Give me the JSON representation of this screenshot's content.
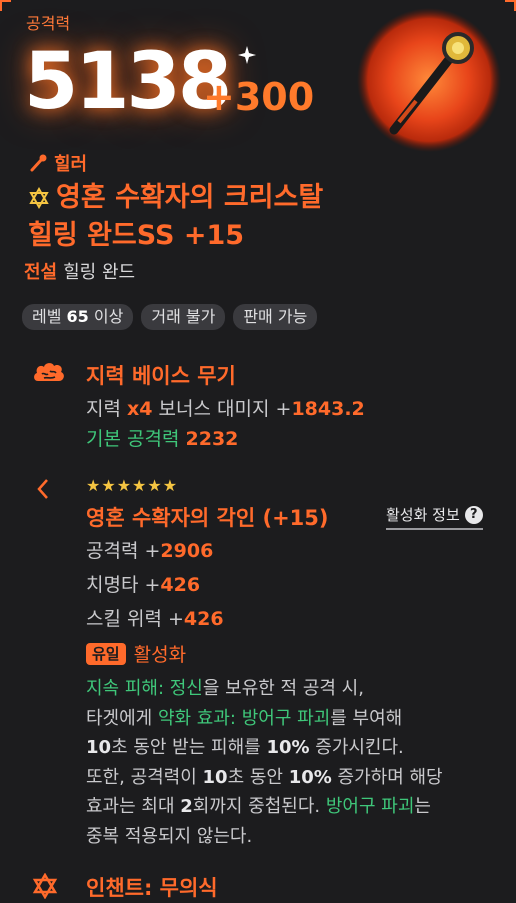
{
  "attack": {
    "label": "공격력",
    "value": "5138",
    "bonus": "+300"
  },
  "item": {
    "class": "힐러",
    "name_line1": "영혼 수확자의 크리스탈",
    "name_line2": "힐링 완드SS +15",
    "grade": "전설",
    "type": "힐링 완드"
  },
  "tags": {
    "level_prefix": "레벨",
    "level_value": "65",
    "level_suffix": "이상",
    "trade": "거래 불가",
    "sell": "판매 가능"
  },
  "base": {
    "title": "지력 베이스 무기",
    "line1_a": "지력",
    "line1_b": "x4",
    "line1_c": "보너스 대미지 +",
    "line1_d": "1843.2",
    "line2_a": "기본 공격력",
    "line2_b": "2232"
  },
  "engraving": {
    "stars": "★★★★★★",
    "title": "영혼 수확자의 각인 (+15)",
    "info_label": "활성화 정보",
    "stats": [
      {
        "label": "공격력 +",
        "value": "2906"
      },
      {
        "label": "치명타 +",
        "value": "426"
      },
      {
        "label": "스킬 위력 +",
        "value": "426"
      }
    ],
    "unique_badge": "유일",
    "unique_label": "활성화",
    "desc": {
      "p1": "지속 피해: 정신",
      "p2": "을 보유한 적 공격 시,",
      "p3": "타겟에게 ",
      "p4": "약화 효과: 방어구 파괴",
      "p5": "를 부여해",
      "p6": "10",
      "p7": "초 동안 받는 피해를 ",
      "p8": "10%",
      "p9": " 증가시킨다.",
      "p10": "또한, 공격력이 ",
      "p11": "10",
      "p12": "초 동안 ",
      "p13": "10%",
      "p14": " 증가하며 해당",
      "p15": "효과는 최대 ",
      "p16": "2",
      "p17": "회까지 중첩된다. ",
      "p18": "방어구 파괴",
      "p19": "는",
      "p20": "중복 적용되지 않는다."
    }
  },
  "enchant": {
    "title": "인챈트: 무의식"
  },
  "colors": {
    "accent": "#ff6a2b",
    "green": "#3fc77a",
    "star": "#f5c542",
    "bg": "#1c1c1e"
  },
  "icons": [
    "spark-icon",
    "wand-icon",
    "star-of-david-icon",
    "brain-icon",
    "chevron-left-icon",
    "question-icon"
  ]
}
